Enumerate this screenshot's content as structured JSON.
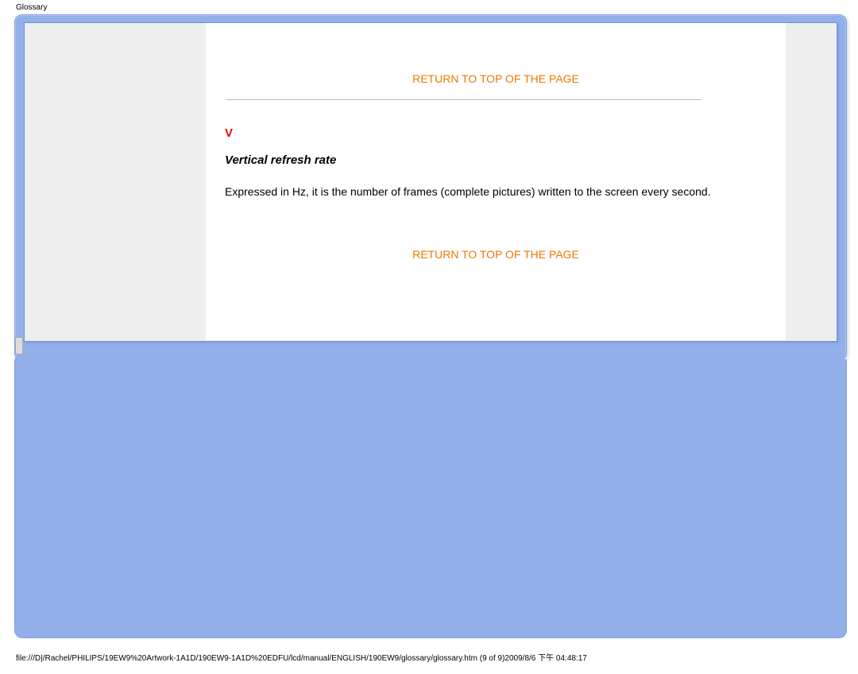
{
  "page_header": "Glossary",
  "links": {
    "return_top_1": "RETURN TO TOP OF THE PAGE",
    "return_top_2": "RETURN TO TOP OF THE PAGE"
  },
  "section": {
    "letter": "V",
    "term": "Vertical refresh rate",
    "definition": "Expressed in Hz, it is the number of frames (complete pictures) written to the screen every second."
  },
  "footer_path": "file:///D|/Rachel/PHILIPS/19EW9%20Artwork-1A1D/190EW9-1A1D%20EDFU/lcd/manual/ENGLISH/190EW9/glossary/glossary.htm (9 of 9)2009/8/6 下午 04:48:17"
}
